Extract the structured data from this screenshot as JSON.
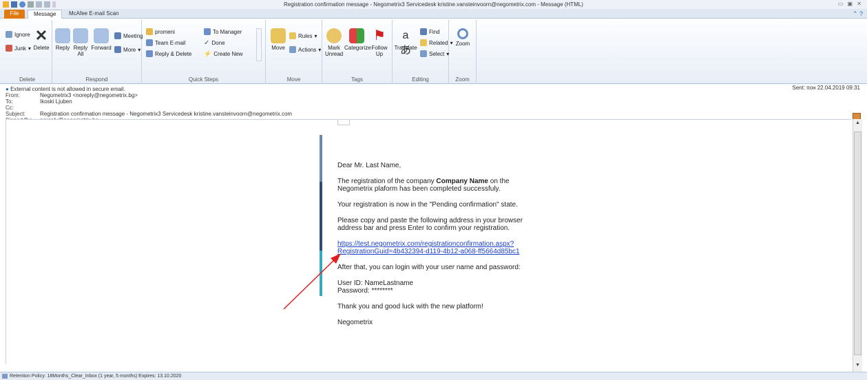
{
  "window": {
    "title": "Registration confirmation message - Negometrix3 Servicedesk kristine.vansteinvoorn@negometrix.com  -  Message (HTML)"
  },
  "tabs": [
    {
      "label": "File"
    },
    {
      "label": "Message"
    },
    {
      "label": "McAfee E-mail Scan"
    }
  ],
  "ribbon": {
    "delete": {
      "ignore": "Ignore",
      "delete": "Delete",
      "junk": "Junk",
      "label": "Delete"
    },
    "respond": {
      "reply": "Reply",
      "reply_all_line1": "Reply",
      "reply_all_line2": "All",
      "forward": "Forward",
      "meeting": "Meeting",
      "more": "More",
      "label": "Respond"
    },
    "quick_steps": {
      "items": [
        "promeni",
        "Team E-mail",
        "Reply & Delete",
        "To Manager",
        "Done",
        "Create New"
      ],
      "label": "Quick Steps"
    },
    "move": {
      "move": "Move",
      "rules": "Rules",
      "actions": "Actions",
      "label": "Move"
    },
    "tags": {
      "mark_unread_line1": "Mark",
      "mark_unread_line2": "Unread",
      "categorize": "Categorize",
      "follow_up_line1": "Follow",
      "follow_up_line2": "Up",
      "label": "Tags"
    },
    "editing": {
      "translate": "Translate",
      "find": "Find",
      "related": "Related",
      "select": "Select",
      "label": "Editing"
    },
    "zoom": {
      "zoom": "Zoom",
      "label": "Zoom"
    }
  },
  "header": {
    "notice": "External content is not allowed in secure email.",
    "from_label": "From:",
    "from": "Negometrix3 <noreply@negometrix.bg>",
    "to_label": "To:",
    "to": "Ikoski Ljuben",
    "cc_label": "Cc:",
    "cc": "",
    "subject_label": "Subject:",
    "subject": "Registration confirmation message - Negometrix3 Servicedesk kristine.vansteinvoorn@negometrix.com",
    "signed_label": "Signed By:",
    "signed_by": "noreply@negometrix.bg",
    "sent_label": "Sent:",
    "sent": "пон 22.04.2019 09:31"
  },
  "body": {
    "greeting": "Dear Mr. Last Name,",
    "reg_prefix": "The registration of the company ",
    "company": "Company Name",
    "reg_suffix": " on the Negometrix plaform has been completed successfuly.",
    "pending": "Your registration is now in the \"Pending confirmation\" state.",
    "instruction": "Please copy and paste the following address in your browser address bar and press Enter to confirm your registration.",
    "link_line1": "https://test.negometrix.com/registrationconfirmation.aspx?",
    "link_line2": "RegistrationGuid=4b432394-d119-4b12-a068-ff5664d85bc1",
    "after": "After that, you can login with your user name and password:",
    "userid": "User ID: NameLastname",
    "password": "Password: ********",
    "thanks": "Thank you and good luck with the new platform!",
    "signature": "Negometrix"
  },
  "status": {
    "text": "Retention Policy:  18Months_Clear_Inbox (1 year, 5 months)   Expires:  13.10.2020"
  },
  "colors": {
    "file_tab": "#e07a10",
    "link": "#1a3fcc",
    "arrow": "#e02020"
  }
}
